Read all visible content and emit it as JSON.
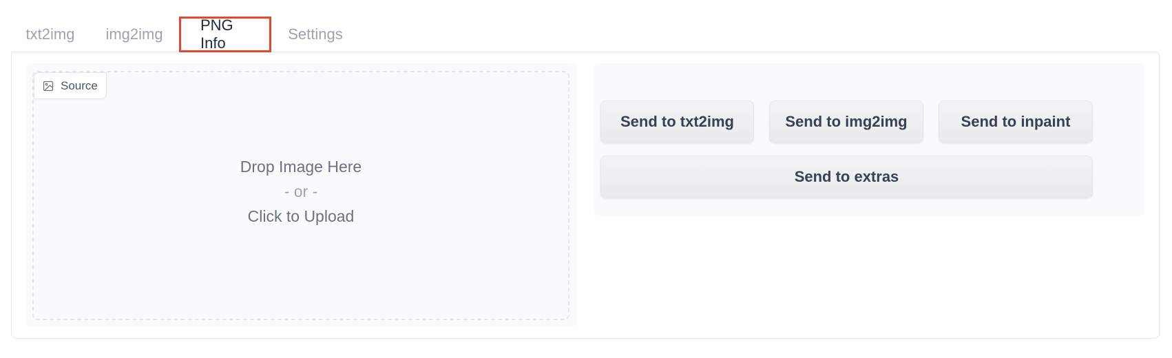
{
  "tabs": [
    {
      "label": "txt2img",
      "active": false
    },
    {
      "label": "img2img",
      "active": false
    },
    {
      "label": "PNG Info",
      "active": true
    },
    {
      "label": "Settings",
      "active": false
    }
  ],
  "source": {
    "label": "Source",
    "icon": "image-icon",
    "drop_line1": "Drop Image Here",
    "drop_or": "- or -",
    "drop_line2": "Click to Upload"
  },
  "actions": {
    "send_txt2img": "Send to txt2img",
    "send_img2img": "Send to img2img",
    "send_inpaint": "Send to inpaint",
    "send_extras": "Send to extras"
  },
  "colors": {
    "active_tab_border": "#e5472f",
    "panel_bg": "#f9fafb",
    "button_bg": "#f3f4f6"
  }
}
